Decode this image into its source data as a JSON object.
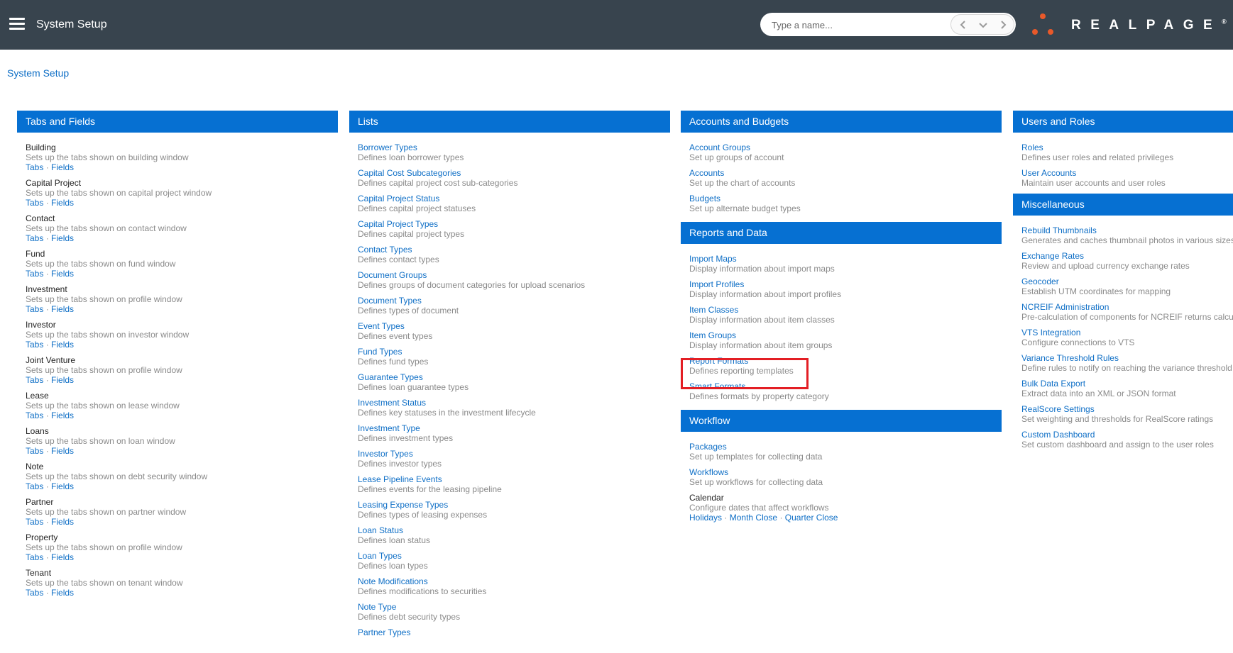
{
  "header": {
    "title": "System Setup",
    "search_placeholder": "Type a name...",
    "brand": "REALPAGE",
    "brand_trademark": "®"
  },
  "breadcrumb": "System Setup",
  "colors": {
    "topbar": "#38444e",
    "section_header": "#0670d2",
    "link": "#0f6fc6",
    "brand_orange": "#e8592a",
    "highlight": "#e31e24"
  },
  "tabs_and_fields": {
    "header": "Tabs and Fields",
    "link_tabs": "Tabs",
    "link_fields": "Fields",
    "separator": "·",
    "items": [
      {
        "title": "Building",
        "desc": "Sets up the tabs shown on building window"
      },
      {
        "title": "Capital Project",
        "desc": "Sets up the tabs shown on capital project window"
      },
      {
        "title": "Contact",
        "desc": "Sets up the tabs shown on contact window"
      },
      {
        "title": "Fund",
        "desc": "Sets up the tabs shown on fund window"
      },
      {
        "title": "Investment",
        "desc": "Sets up the tabs shown on profile window"
      },
      {
        "title": "Investor",
        "desc": "Sets up the tabs shown on investor window"
      },
      {
        "title": "Joint Venture",
        "desc": "Sets up the tabs shown on profile window"
      },
      {
        "title": "Lease",
        "desc": "Sets up the tabs shown on lease window"
      },
      {
        "title": "Loans",
        "desc": "Sets up the tabs shown on loan window"
      },
      {
        "title": "Note",
        "desc": "Sets up the tabs shown on debt security window"
      },
      {
        "title": "Partner",
        "desc": "Sets up the tabs shown on partner window"
      },
      {
        "title": "Property",
        "desc": "Sets up the tabs shown on profile window"
      },
      {
        "title": "Tenant",
        "desc": "Sets up the tabs shown on tenant window"
      }
    ]
  },
  "lists": {
    "header": "Lists",
    "items": [
      {
        "title": "Borrower Types",
        "desc": "Defines loan borrower types"
      },
      {
        "title": "Capital Cost Subcategories",
        "desc": "Defines capital project cost sub-categories"
      },
      {
        "title": "Capital Project Status",
        "desc": "Defines capital project statuses"
      },
      {
        "title": "Capital Project Types",
        "desc": "Defines capital project types"
      },
      {
        "title": "Contact Types",
        "desc": "Defines contact types"
      },
      {
        "title": "Document Groups",
        "desc": "Defines groups of document categories for upload scenarios"
      },
      {
        "title": "Document Types",
        "desc": "Defines types of document"
      },
      {
        "title": "Event Types",
        "desc": "Defines event types"
      },
      {
        "title": "Fund Types",
        "desc": "Defines fund types"
      },
      {
        "title": "Guarantee Types",
        "desc": "Defines loan guarantee types"
      },
      {
        "title": "Investment Status",
        "desc": "Defines key statuses in the investment lifecycle"
      },
      {
        "title": "Investment Type",
        "desc": "Defines investment types"
      },
      {
        "title": "Investor Types",
        "desc": "Defines investor types"
      },
      {
        "title": "Lease Pipeline Events",
        "desc": "Defines events for the leasing pipeline"
      },
      {
        "title": "Leasing Expense Types",
        "desc": "Defines types of leasing expenses"
      },
      {
        "title": "Loan Status",
        "desc": "Defines loan status"
      },
      {
        "title": "Loan Types",
        "desc": "Defines loan types"
      },
      {
        "title": "Note Modifications",
        "desc": "Defines modifications to securities"
      },
      {
        "title": "Note Type",
        "desc": "Defines debt security types"
      },
      {
        "title": "Partner Types",
        "desc": ""
      }
    ]
  },
  "accounts_and_budgets": {
    "header": "Accounts and Budgets",
    "items": [
      {
        "title": "Account Groups",
        "desc": "Set up groups of account"
      },
      {
        "title": "Accounts",
        "desc": "Set up the chart of accounts"
      },
      {
        "title": "Budgets",
        "desc": "Set up alternate budget types"
      }
    ]
  },
  "reports_and_data": {
    "header": "Reports and Data",
    "items": [
      {
        "title": "Import Maps",
        "desc": "Display information about import maps"
      },
      {
        "title": "Import Profiles",
        "desc": "Display information about import profiles"
      },
      {
        "title": "Item Classes",
        "desc": "Display information about item classes"
      },
      {
        "title": "Item Groups",
        "desc": "Display information about item groups"
      },
      {
        "title": "Report Formats",
        "desc": "Defines reporting templates"
      },
      {
        "title": "Smart Formats",
        "desc": "Defines formats by property category"
      }
    ]
  },
  "workflow": {
    "header": "Workflow",
    "items": [
      {
        "title": "Packages",
        "desc": "Set up templates for collecting data"
      },
      {
        "title": "Workflows",
        "desc": "Set up workflows for collecting data"
      }
    ],
    "calendar": {
      "title": "Calendar",
      "desc": "Configure dates that affect workflows",
      "links": [
        "Holidays",
        "Month Close",
        "Quarter Close"
      ]
    }
  },
  "users_and_roles": {
    "header": "Users and Roles",
    "items": [
      {
        "title": "Roles",
        "desc": "Defines user roles and related privileges"
      },
      {
        "title": "User Accounts",
        "desc": "Maintain user accounts and user roles"
      }
    ]
  },
  "miscellaneous": {
    "header": "Miscellaneous",
    "items": [
      {
        "title": "Rebuild Thumbnails",
        "desc": "Generates and caches thumbnail photos in various sizes"
      },
      {
        "title": "Exchange Rates",
        "desc": "Review and upload currency exchange rates"
      },
      {
        "title": "Geocoder",
        "desc": "Establish UTM coordinates for mapping"
      },
      {
        "title": "NCREIF Administration",
        "desc": "Pre-calculation of components for NCREIF returns calcu"
      },
      {
        "title": "VTS Integration",
        "desc": "Configure connections to VTS"
      },
      {
        "title": "Variance Threshold Rules",
        "desc": "Define rules to notify on reaching the variance threshold"
      },
      {
        "title": "Bulk Data Export",
        "desc": "Extract data into an XML or JSON format"
      },
      {
        "title": "RealScore Settings",
        "desc": "Set weighting and thresholds for RealScore ratings"
      },
      {
        "title": "Custom Dashboard",
        "desc": "Set custom dashboard and assign to the user roles"
      }
    ]
  }
}
